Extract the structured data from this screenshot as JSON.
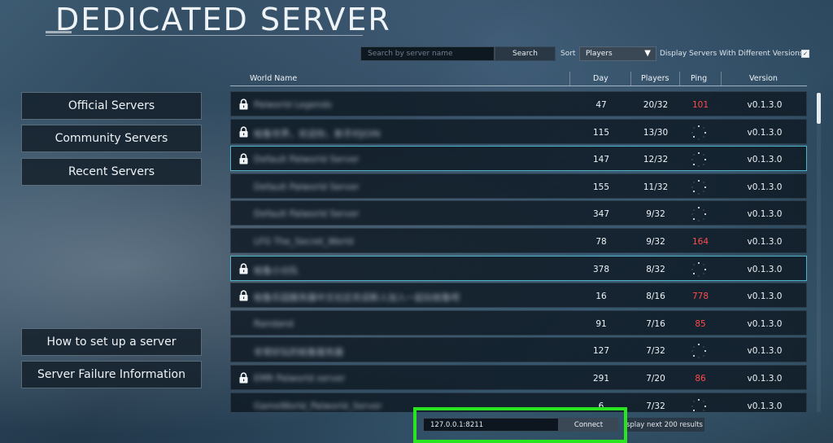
{
  "page": {
    "title": "DEDICATED SERVER"
  },
  "search": {
    "placeholder": "Search by server name",
    "button_label": "Search"
  },
  "sort": {
    "label": "Sort",
    "selected": "Players",
    "versions_label": "Display Servers With Different Versions",
    "versions_checked": true
  },
  "sidebar": {
    "items": [
      {
        "label": "Official Servers"
      },
      {
        "label": "Community Servers"
      },
      {
        "label": "Recent Servers"
      }
    ],
    "help": [
      {
        "label": "How to set up a server"
      },
      {
        "label": "Server Failure Information"
      }
    ]
  },
  "table": {
    "headers": {
      "world_name": "World Name",
      "day": "Day",
      "players": "Players",
      "ping": "Ping",
      "version": "Version"
    },
    "rows": [
      {
        "name": "Palworld Legends",
        "locked": true,
        "day": "47",
        "players": "20/32",
        "ping": "101",
        "version": "v0.1.3.0"
      },
      {
        "name": "帕鲁世界，欢迎你，新手村JOIN",
        "locked": true,
        "day": "115",
        "players": "13/30",
        "ping": "",
        "version": "v0.1.3.0"
      },
      {
        "name": "Default Palworld Server",
        "locked": true,
        "day": "147",
        "players": "12/32",
        "ping": "",
        "version": "v0.1.3.0"
      },
      {
        "name": "Default Palworld Server",
        "locked": false,
        "day": "155",
        "players": "11/32",
        "ping": "",
        "version": "v0.1.3.0"
      },
      {
        "name": "Default Palworld Server",
        "locked": false,
        "day": "347",
        "players": "9/32",
        "ping": "",
        "version": "v0.1.3.0"
      },
      {
        "name": "LFG The_Secret_World",
        "locked": false,
        "day": "78",
        "players": "9/32",
        "ping": "164",
        "version": "v0.1.3.0"
      },
      {
        "name": "帕鲁小分队",
        "locked": true,
        "day": "378",
        "players": "8/32",
        "ping": "",
        "version": "v0.1.3.0"
      },
      {
        "name": "帕鲁乐园服务器中文社区欢迎新人加入一起玩帕鲁吧",
        "locked": true,
        "day": "16",
        "players": "8/16",
        "ping": "778",
        "version": "v0.1.3.0"
      },
      {
        "name": "Randand",
        "locked": false,
        "day": "91",
        "players": "7/16",
        "ping": "85",
        "version": "v0.1.3.0"
      },
      {
        "name": "非常好玩的帕鲁服务器",
        "locked": false,
        "day": "127",
        "players": "7/32",
        "ping": "",
        "version": "v0.1.3.0"
      },
      {
        "name": "EMR Palworld server",
        "locked": true,
        "day": "291",
        "players": "7/20",
        "ping": "86",
        "version": "v0.1.3.0"
      },
      {
        "name": "GameWorld_Palworld_Server",
        "locked": false,
        "day": "6",
        "players": "7/32",
        "ping": "",
        "version": "v0.1.3.0"
      }
    ]
  },
  "connect": {
    "address": "127.0.0.1:8211",
    "button_label": "Connect"
  },
  "next_results": {
    "label": "Display next 200 results"
  },
  "colors": {
    "highlight": "#29e51f",
    "ping_red": "#ff4b4b",
    "selected_border": "#4fb3c8"
  }
}
